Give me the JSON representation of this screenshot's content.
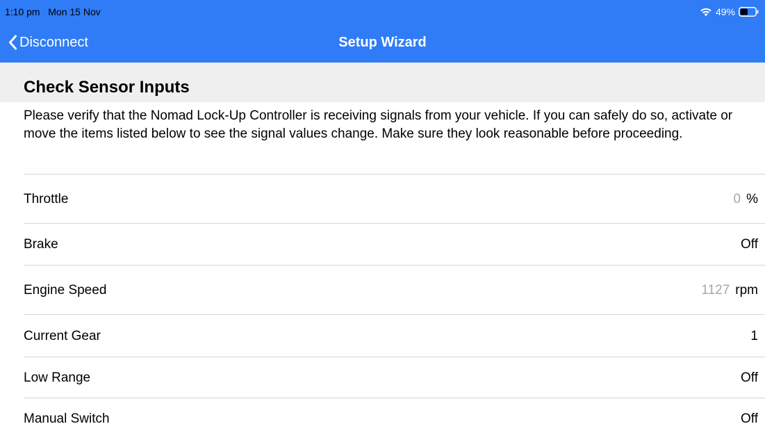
{
  "status_bar": {
    "time": "1:10 pm",
    "date": "Mon 15 Nov",
    "battery": "49%",
    "icons": [
      "wifi-icon",
      "battery-icon"
    ]
  },
  "nav": {
    "back_label": "Disconnect",
    "back_icon": "chevron-left-icon",
    "title": "Setup Wizard"
  },
  "section": {
    "title": "Check Sensor Inputs",
    "description": "Please verify that the Nomad Lock-Up Controller is receiving signals from your vehicle. If you can safely do so, activate or move the items listed below to see the signal values change. Make sure they look reasonable before proceeding."
  },
  "rows": [
    {
      "label": "Throttle",
      "value": "0",
      "unit": "%"
    },
    {
      "label": "Brake",
      "value": "Off"
    },
    {
      "label": "Engine Speed",
      "value": "1127",
      "unit": "rpm"
    },
    {
      "label": "Current Gear",
      "value": "1"
    },
    {
      "label": "Low Range",
      "value": "Off"
    },
    {
      "label": "Manual Switch",
      "value": "Off"
    }
  ],
  "colors": {
    "header_bg": "#2f7cf6",
    "section_bg": "#efeff0",
    "muted_value": "#a6a6ab",
    "divider": "#d6d6d8"
  }
}
